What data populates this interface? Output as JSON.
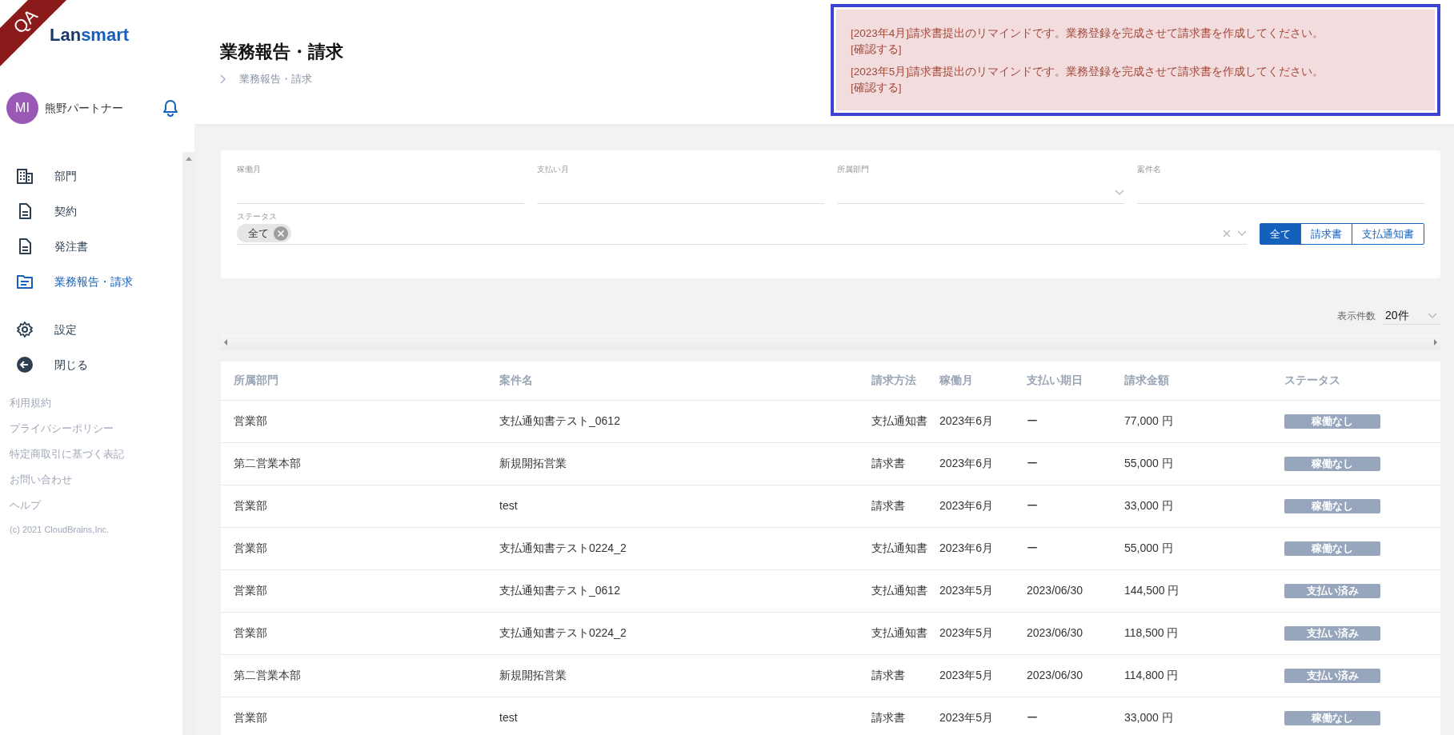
{
  "env_badge": "QA",
  "logo": {
    "prefix": "Lan",
    "suffix": "smart"
  },
  "user": {
    "initials": "MI",
    "name": "熊野パートナー"
  },
  "nav": [
    {
      "label": "部門",
      "selected": false
    },
    {
      "label": "契約",
      "selected": false
    },
    {
      "label": "発注書",
      "selected": false
    },
    {
      "label": "業務報告・請求",
      "selected": true
    },
    {
      "label": "設定",
      "selected": false
    },
    {
      "label": "閉じる",
      "selected": false
    }
  ],
  "footer_links": [
    "利用規約",
    "プライバシーポリシー",
    "特定商取引に基づく表記",
    "お問い合わせ",
    "ヘルプ"
  ],
  "copyright": "(c) 2021 CloudBrains,Inc.",
  "page": {
    "title": "業務報告・請求",
    "breadcrumb": "業務報告・請求"
  },
  "alerts": [
    {
      "text": "[2023年4月]請求書提出のリマインドです。業務登録を完成させて請求書を作成してください。",
      "link": "[確認する]"
    },
    {
      "text": "[2023年5月]請求書提出のリマインドです。業務登録を完成させて請求書を作成してください。",
      "link": "[確認する]"
    }
  ],
  "filters": [
    {
      "label": "稼働月",
      "kind": "text"
    },
    {
      "label": "支払い月",
      "kind": "text"
    },
    {
      "label": "所属部門",
      "kind": "select"
    },
    {
      "label": "案件名",
      "kind": "text"
    }
  ],
  "status_filter": {
    "label": "ステータス",
    "chips": [
      "全て"
    ]
  },
  "method_toggle": [
    {
      "label": "全て",
      "selected": true
    },
    {
      "label": "請求書",
      "selected": false
    },
    {
      "label": "支払通知書",
      "selected": false
    }
  ],
  "page_size": {
    "label": "表示件数",
    "value": "20件"
  },
  "table": {
    "columns": [
      "所属部門",
      "案件名",
      "請求方法",
      "稼働月",
      "支払い期日",
      "請求金額",
      "ステータス"
    ],
    "rows": [
      [
        "営業部",
        "支払通知書テスト_0612",
        "支払通知書",
        "2023年6月",
        "ー",
        "77,000 円",
        "稼働なし"
      ],
      [
        "第二営業本部",
        "新規開拓営業",
        "請求書",
        "2023年6月",
        "ー",
        "55,000 円",
        "稼働なし"
      ],
      [
        "営業部",
        "test",
        "請求書",
        "2023年6月",
        "ー",
        "33,000 円",
        "稼働なし"
      ],
      [
        "営業部",
        "支払通知書テスト0224_2",
        "支払通知書",
        "2023年6月",
        "ー",
        "55,000 円",
        "稼働なし"
      ],
      [
        "営業部",
        "支払通知書テスト_0612",
        "支払通知書",
        "2023年5月",
        "2023/06/30",
        "144,500 円",
        "支払い済み"
      ],
      [
        "営業部",
        "支払通知書テスト0224_2",
        "支払通知書",
        "2023年5月",
        "2023/06/30",
        "118,500 円",
        "支払い済み"
      ],
      [
        "第二営業本部",
        "新規開拓営業",
        "請求書",
        "2023年5月",
        "2023/06/30",
        "114,800 円",
        "支払い済み"
      ],
      [
        "営業部",
        "test",
        "請求書",
        "2023年5月",
        "ー",
        "33,000 円",
        "稼働なし"
      ]
    ]
  }
}
